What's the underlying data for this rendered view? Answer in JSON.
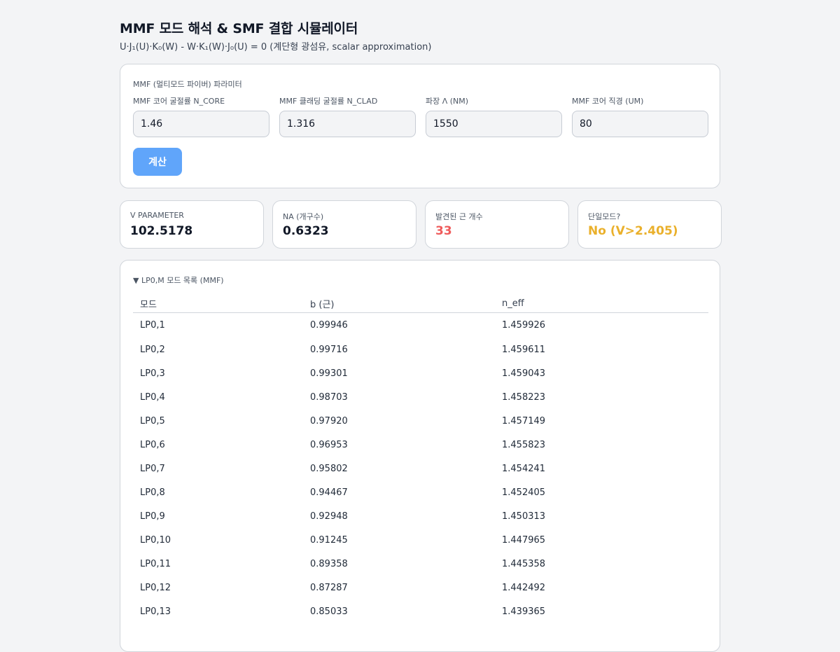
{
  "header": {
    "title": "MMF 모드 해석 & SMF 결합 시뮬레이터",
    "subtitle": "U·J₁(U)·K₀(W) - W·K₁(W)·J₀(U) = 0 (계단형 광섬유, scalar approximation)"
  },
  "params": {
    "section_title": "MMF (멀티모드 파이버) 파라미터",
    "fields": [
      {
        "label": "MMF 코어 굴절률 N_CORE",
        "value": "1.46"
      },
      {
        "label": "MMF 클래딩 굴절률 N_CLAD",
        "value": "1.316"
      },
      {
        "label": "파장 Λ (NM)",
        "value": "1550"
      },
      {
        "label": "MMF 코어 직경 (UM)",
        "value": "80"
      }
    ],
    "calc_button": "계산"
  },
  "stats": [
    {
      "label": "V PARAMETER",
      "value": "102.5178",
      "color": "#111827"
    },
    {
      "label": "NA (개구수)",
      "value": "0.6323",
      "color": "#111827"
    },
    {
      "label": "발견된 근 개수",
      "value": "33",
      "color": "#ef5b5b"
    },
    {
      "label": "단일모드?",
      "value": "No (V>2.405)",
      "color": "#eab02b"
    }
  ],
  "modes": {
    "toggle_label": "▼ LP0,M 모드 목록 (MMF)",
    "columns": [
      "모드",
      "b (근)",
      "n_eff"
    ],
    "rows": [
      [
        "LP0,1",
        "0.99946",
        "1.459926"
      ],
      [
        "LP0,2",
        "0.99716",
        "1.459611"
      ],
      [
        "LP0,3",
        "0.99301",
        "1.459043"
      ],
      [
        "LP0,4",
        "0.98703",
        "1.458223"
      ],
      [
        "LP0,5",
        "0.97920",
        "1.457149"
      ],
      [
        "LP0,6",
        "0.96953",
        "1.455823"
      ],
      [
        "LP0,7",
        "0.95802",
        "1.454241"
      ],
      [
        "LP0,8",
        "0.94467",
        "1.452405"
      ],
      [
        "LP0,9",
        "0.92948",
        "1.450313"
      ],
      [
        "LP0,10",
        "0.91245",
        "1.447965"
      ],
      [
        "LP0,11",
        "0.89358",
        "1.445358"
      ],
      [
        "LP0,12",
        "0.87287",
        "1.442492"
      ],
      [
        "LP0,13",
        "0.85033",
        "1.439365"
      ]
    ]
  }
}
